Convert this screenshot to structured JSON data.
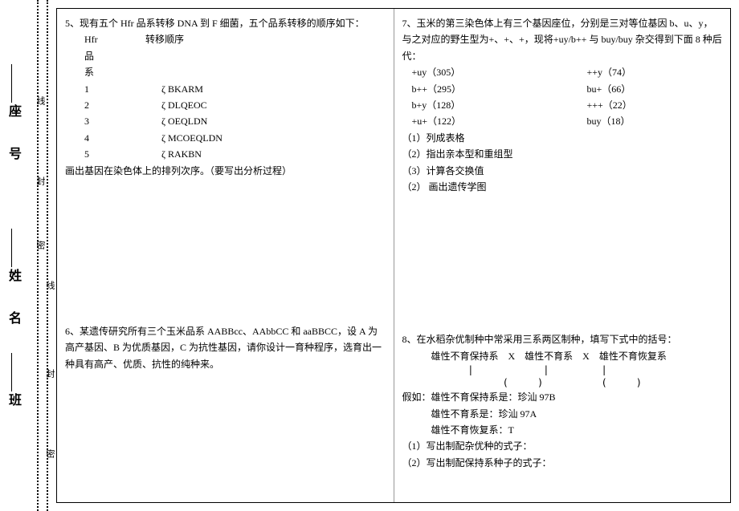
{
  "strip": {
    "labels": [
      "座 号",
      "姓 名",
      "班"
    ],
    "seals": [
      "线",
      "封",
      "密",
      "线",
      "封",
      "密"
    ]
  },
  "left": {
    "q5": {
      "title": "5、现有五个 Hfr 品系转移 DNA 到 F 细菌，五个品系转移的顺序如下：",
      "hdr_a": "Hfr 品系",
      "hdr_b": "转移顺序",
      "rows": [
        {
          "n": "1",
          "seq": "ζ BKARM"
        },
        {
          "n": "2",
          "seq": "ζ DLQEOC"
        },
        {
          "n": "3",
          "seq": "ζ OEQLDN"
        },
        {
          "n": "4",
          "seq": "ζ MCOEQLDN"
        },
        {
          "n": "5",
          "seq": "ζ RAKBN"
        }
      ],
      "tail": "画出基因在染色体上的排列次序。（要写出分析过程）"
    },
    "q6": "6、某遗传研究所有三个玉米品系 AABBcc、AAbbCC 和 aaBBCC，设 A 为高产基因、B 为优质基因，C 为抗性基因，请你设计一育种程序，选育出一种具有高产、优质、抗性的纯种来。"
  },
  "right": {
    "q7": {
      "title": "7、玉米的第三染色体上有三个基因座位，分别是三对等位基因 b、u、y，与之对应的野生型为+、+、+，现将+uy/b++ 与 buy/buy 杂交得到下面 8 种后代：",
      "rows": [
        {
          "l": "+uy（305）",
          "r": "++y（74）"
        },
        {
          "l": "b++（295）",
          "r": "bu+（66）"
        },
        {
          "l": "b+y（128）",
          "r": "+++（22）"
        },
        {
          "l": "+u+（122）",
          "r": "buy（18）"
        }
      ],
      "items": [
        "（1）列成表格",
        "（2）指出亲本型和重组型",
        "（3）计算各交换值",
        "（2）  画出遗传学图"
      ]
    },
    "q8": {
      "title": "8、在水稻杂优制种中常采用三系两区制种，填写下式中的括号：",
      "line1": "雄性不育保持系　X　雄性不育系　X　雄性不育恢复系",
      "diagram": "        |            |         |\n              (     )          (     )",
      "assume": "假如：雄性不育保持系是：珍汕 97B",
      "a2": "雄性不育系是：珍汕 97A",
      "a3": "雄性不育恢复系：T",
      "p1": "（1）写出制配杂优种的式子：",
      "p2": "（2）写出制配保持系种子的式子："
    }
  }
}
